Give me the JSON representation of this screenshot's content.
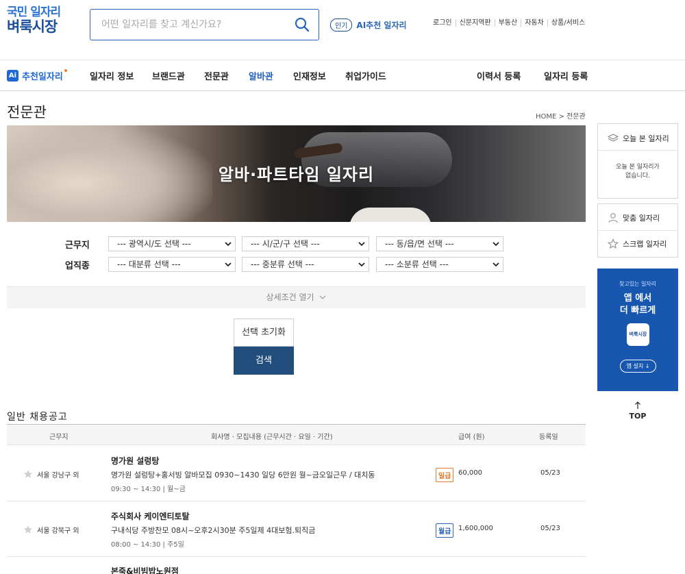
{
  "header": {
    "logo_line1": "국민 일자리",
    "logo_line2": "벼룩시장",
    "search_placeholder": "어떤 일자리를 찾고 계신가요?",
    "popular_badge": "인기",
    "popular_text": "AI추천 일자리",
    "top_links": [
      "로그인",
      "신문지역판",
      "부동산",
      "자동차",
      "상품/서비스"
    ]
  },
  "nav": {
    "ai_label": "추천일자리",
    "ai_box": "Ai",
    "items": [
      "일자리 정보",
      "브랜드관",
      "전문관",
      "알바관",
      "인재정보",
      "취업가이드"
    ],
    "right_items": [
      "이력서 등록",
      "일자리 등록"
    ]
  },
  "page": {
    "title": "전문관",
    "breadcrumb": "HOME > 전문관",
    "banner_title": "알바·파트타임 일자리"
  },
  "filters": {
    "work_location_label": "근무지",
    "job_type_label": "업직종",
    "location_selects": [
      "--- 광역시/도 선택 ---",
      "--- 시/군/구 선택 ---",
      "--- 동/읍/면 선택 ---"
    ],
    "job_selects": [
      "--- 대분류 선택 ---",
      "--- 중분류 선택 ---",
      "--- 소분류 선택 ---"
    ],
    "detail_toggle": "상세조건 열기",
    "reset_label": "선택 초기화",
    "search_label": "검색"
  },
  "listings": {
    "section_title": "일반 채용공고",
    "columns": [
      "근무지",
      "회사명 · 모집내용 (근무시간 · 요일 · 기간)",
      "급여 (원)",
      "등록일"
    ],
    "rows": [
      {
        "location": "서울 강남구 외",
        "company": "명가원 설렁탕",
        "description": "명가원 설렁탕+홍서빙 알바모집 0930~1430 일당 6만원 월~금오일근무 / 대치동",
        "time": "09:30 ~ 14:30",
        "days": "월~금",
        "pay_type": "일급",
        "pay": "60,000",
        "date": "05/23"
      },
      {
        "location": "서울 강북구 외",
        "company": "주식회사 케이엔티토탈",
        "description": "구내식당 주방찬모 08시~오후2시30분 주5일제 4대보험.퇴직금",
        "time": "08:00 ~ 14:30",
        "days": "주5일",
        "pay_type": "월급",
        "pay": "1,600,000",
        "date": "05/23"
      },
      {
        "company": "본죽&비빔밥노원점"
      }
    ]
  },
  "side": {
    "today_viewed": "오늘 본 일자리",
    "today_empty_line1": "오늘 본 일자리가",
    "today_empty_line2": "없습니다.",
    "custom_jobs": "맞춤 일자리",
    "scrap_jobs": "스크랩 일자리",
    "app_small": "찾고있는 일자리",
    "app_big_line1": "앱 에서",
    "app_big_line2": "더 빠르게",
    "app_icon_text": "벼룩시장",
    "app_install": "앱 설치 ↓",
    "top": "TOP"
  }
}
